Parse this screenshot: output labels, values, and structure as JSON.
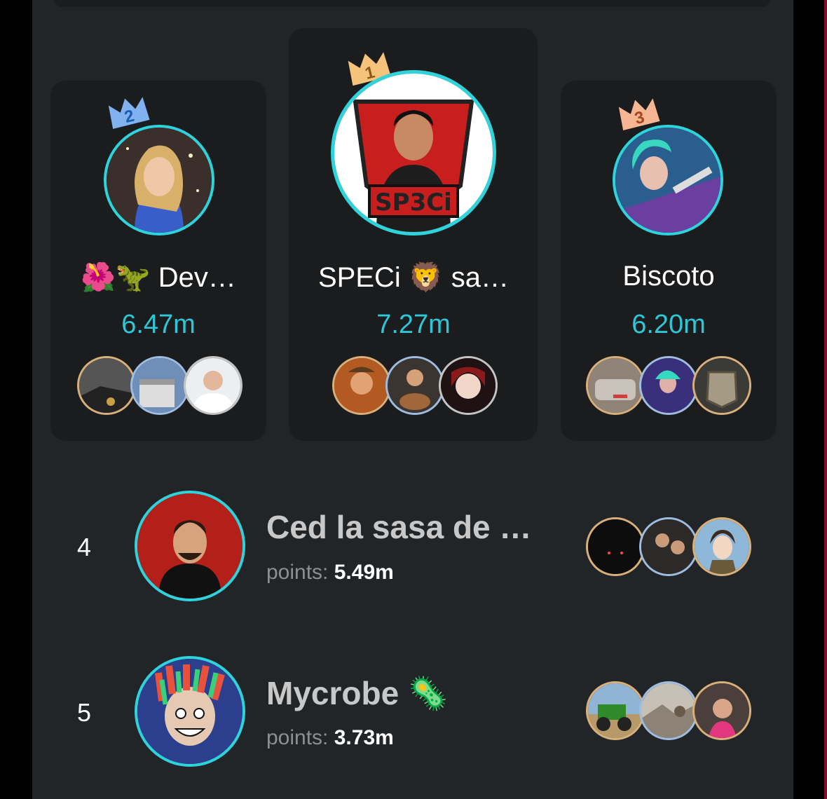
{
  "podium": [
    {
      "rank_badge": "2",
      "name": "🌺🦖 Dev…",
      "points": "6.47m",
      "badge_color": "#7fb2ee",
      "badge_text_color": "#1a5cb3"
    },
    {
      "rank_badge": "1",
      "name": "SPECi 🦁 sa…",
      "points": "7.27m",
      "badge_color": "#f5c37a",
      "badge_text_color": "#8a5a1a"
    },
    {
      "rank_badge": "3",
      "name": "Biscoto",
      "points": "6.20m",
      "badge_color": "#f6b694",
      "badge_text_color": "#a4471f"
    }
  ],
  "list": [
    {
      "rank": "4",
      "name": "Ced la sasa de …",
      "points_label": "points:",
      "points_value": "5.49m"
    },
    {
      "rank": "5",
      "name": "Mycrobe 🦠",
      "points_label": "points:",
      "points_value": "3.73m"
    }
  ],
  "colors": {
    "accent": "#2ed3db",
    "background": "#222528",
    "card": "#1a1c1e"
  }
}
